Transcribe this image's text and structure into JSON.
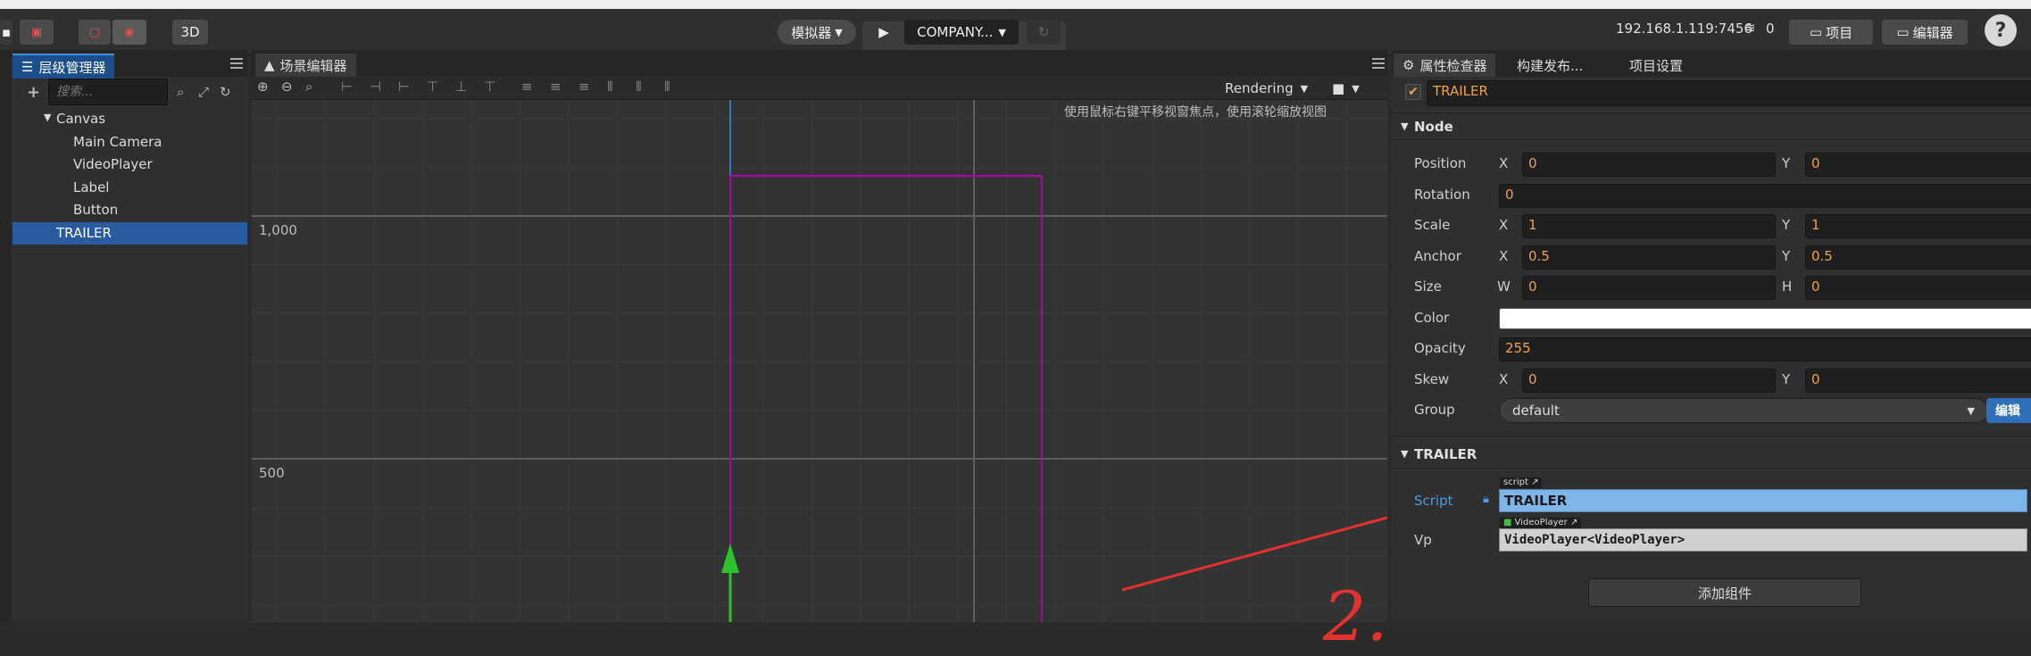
{
  "toolbar": {
    "btn_3d": "3D",
    "simulator": "模拟器",
    "device": "COMPANY...",
    "ip": "192.168.1.119:7456",
    "clients": "0",
    "project_btn": "项目",
    "editor_btn": "编辑器",
    "help": "?"
  },
  "hierarchy": {
    "tab": "层级管理器",
    "search_placeholder": "搜索...",
    "items": [
      "Canvas",
      "Main Camera",
      "VideoPlayer",
      "Label",
      "Button",
      "TRAILER"
    ]
  },
  "scene": {
    "tab": "场景编辑器",
    "rendering": "Rendering",
    "hint": "使用鼠标右键平移视窗焦点，使用滚轮缩放视图",
    "label_1000": "1,000",
    "label_500": "500",
    "annotation": "2."
  },
  "inspector": {
    "tabs": [
      "属性检查器",
      "构建发布...",
      "项目设置"
    ],
    "node_name": "TRAILER",
    "node_section": "Node",
    "labels": {
      "position": "Position",
      "rotation": "Rotation",
      "scale": "Scale",
      "anchor": "Anchor",
      "size": "Size",
      "color": "Color",
      "opacity": "Opacity",
      "skew": "Skew",
      "group": "Group"
    },
    "axes": {
      "x": "X",
      "y": "Y",
      "w": "W",
      "h": "H"
    },
    "values": {
      "pos_x": "0",
      "pos_y": "0",
      "rotation": "0",
      "scale_x": "1",
      "scale_y": "1",
      "anchor_x": "0.5",
      "anchor_y": "0.5",
      "size_w": "0",
      "size_h": "0",
      "opacity": "255",
      "skew_x": "0",
      "skew_y": "0",
      "group": "default",
      "edit": "编辑"
    },
    "component_section": "TRAILER",
    "script_label": "Script",
    "script_tag": "script",
    "script_value": "TRAILER",
    "vp_label": "Vp",
    "vp_tag": "VideoPlayer",
    "vp_value": "VideoPlayer<VideoPlayer>",
    "add_component": "添加组件"
  },
  "colors": {
    "accent": "#1b4e8a",
    "value_orange": "#f0a24a",
    "selection_magenta": "#b000b0",
    "annotation_red": "#e53030"
  }
}
